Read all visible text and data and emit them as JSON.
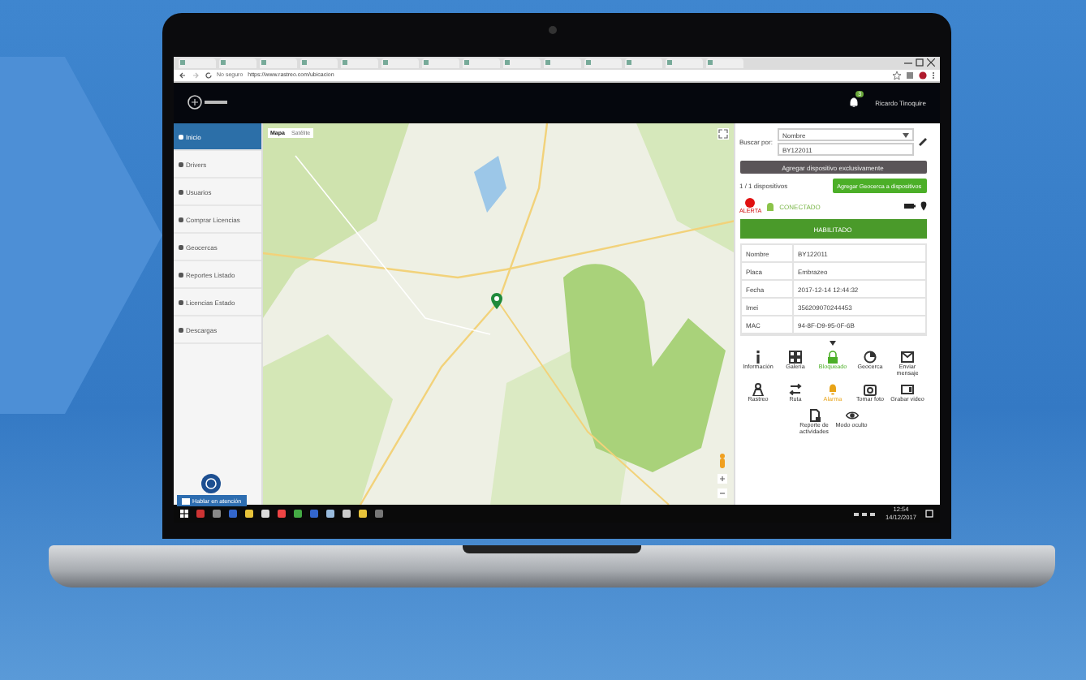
{
  "browser": {
    "security": "No seguro",
    "url": "https://www.rastreo.com/ubicacion"
  },
  "header": {
    "user": "Ricardo Tinoquire",
    "badge": "3"
  },
  "sidebar": {
    "items": [
      {
        "label": "Inicio",
        "selected": true
      },
      {
        "label": "Drivers",
        "selected": false
      },
      {
        "label": "Usuarios",
        "selected": false
      },
      {
        "label": "Comprar Licencias",
        "selected": false
      },
      {
        "label": "Geocercas",
        "selected": false
      },
      {
        "label": "Reportes Listado",
        "selected": false
      },
      {
        "label": "Licencias Estado",
        "selected": false
      },
      {
        "label": "Descargas",
        "selected": false
      }
    ]
  },
  "map": {
    "types": [
      {
        "label": "Mapa",
        "selected": true
      },
      {
        "label": "Satélite",
        "selected": false
      }
    ]
  },
  "panel": {
    "search_label": "Buscar por:",
    "search_type": "Nombre",
    "search_value": "BY122011",
    "add_exclusive": "Agregar dispositivo exclusivamente",
    "device_count": "1 / 1 dispositivos",
    "add_geofence": "Agregar Geocerca a dispositivos",
    "alert_label": "ALERTA",
    "status": "CONECTADO",
    "state_bar": "HABILITADO",
    "details": [
      {
        "label": "Nombre",
        "value": "BY122011"
      },
      {
        "label": "Placa",
        "value": "Embrazeo"
      },
      {
        "label": "Fecha",
        "value": "2017-12-14 12:44:32"
      },
      {
        "label": "Imei",
        "value": "356209070244453"
      },
      {
        "label": "MAC",
        "value": "94-8F-D9-95-0F-6B"
      }
    ],
    "actions": [
      {
        "label": "Información",
        "color": "#333333"
      },
      {
        "label": "Galería",
        "color": "#333333"
      },
      {
        "label": "Bloqueado",
        "color": "#4caf28"
      },
      {
        "label": "Geocerca",
        "color": "#333333"
      },
      {
        "label": "Enviar mensaje",
        "color": "#333333"
      },
      {
        "label": "Rastreo",
        "color": "#333333"
      },
      {
        "label": "Ruta",
        "color": "#333333"
      },
      {
        "label": "Alarma",
        "color": "#e8a317"
      },
      {
        "label": "Tomar foto",
        "color": "#333333"
      },
      {
        "label": "Grabar video",
        "color": "#333333"
      },
      {
        "label": "Reporte de actividades",
        "color": "#333333"
      },
      {
        "label": "Modo oculto",
        "color": "#333333"
      }
    ]
  },
  "chat": {
    "label": "Hablar en atención"
  },
  "taskbar": {
    "time": "12:54",
    "date": "14/12/2017"
  }
}
